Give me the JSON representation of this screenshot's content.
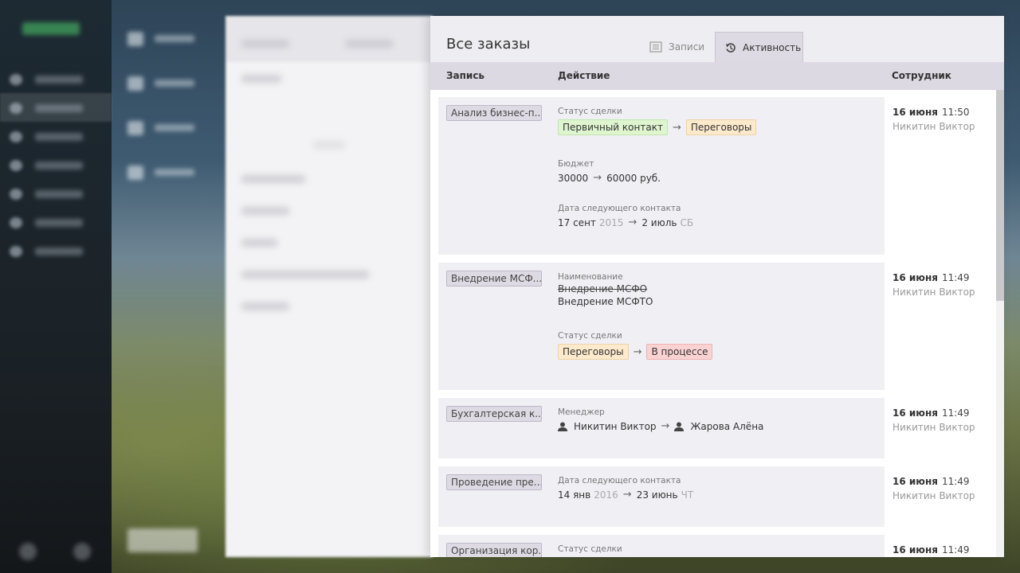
{
  "panel": {
    "title": "Все заказы",
    "tabs": [
      {
        "label": "Записи",
        "icon": "list-icon",
        "active": false
      },
      {
        "label": "Активность",
        "icon": "history-icon",
        "active": true
      }
    ],
    "columns": {
      "record": "Запись",
      "action": "Действие",
      "employee": "Сотрудник"
    }
  },
  "entries": [
    {
      "record": "Анализ бизнес-п...",
      "date": "16 июня",
      "time": "11:50",
      "employee": "Никитин Виктор",
      "status": {
        "label": "Статус сделки",
        "from": "Первичный контакт",
        "to": "Переговоры"
      },
      "budget": {
        "label": "Бюджет",
        "from": "30000",
        "to": "60000 руб."
      },
      "next_contact": {
        "label": "Дата следующего контакта",
        "from": "17 сент",
        "from_year": "2015",
        "to": "2 июль",
        "to_day": "СБ"
      }
    },
    {
      "record": "Внедрение МСФ...",
      "date": "16 июня",
      "time": "11:49",
      "employee": "Никитин Виктор",
      "name": {
        "label": "Наименование",
        "old": "Внедрение МСФО",
        "new": "Внедрение МСФТО"
      },
      "status": {
        "label": "Статус сделки",
        "from": "Переговоры",
        "to": "В процессе"
      }
    },
    {
      "record": "Бухгалтерская к...",
      "date": "16 июня",
      "time": "11:49",
      "employee": "Никитин Виктор",
      "manager": {
        "label": "Менеджер",
        "from": "Никитин Виктор",
        "to": "Жарова Алёна"
      }
    },
    {
      "record": "Проведение пре...",
      "date": "16 июня",
      "time": "11:49",
      "employee": "Никитин Виктор",
      "next_contact": {
        "label": "Дата следующего контакта",
        "from": "14 янв",
        "from_year": "2016",
        "to": "23 июнь",
        "to_day": "ЧТ"
      }
    },
    {
      "record": "Организация кор...",
      "date": "16 июня",
      "time": "11:49",
      "status": {
        "label": "Статус сделки"
      }
    }
  ],
  "colors": {
    "header_bg": "#eeedf1",
    "column_header_bg": "#ddd9e3",
    "card_bg": "#f0eff4",
    "badge_green": "#def5cf",
    "badge_orange": "#fde9cc",
    "badge_red": "#fad2d2"
  }
}
